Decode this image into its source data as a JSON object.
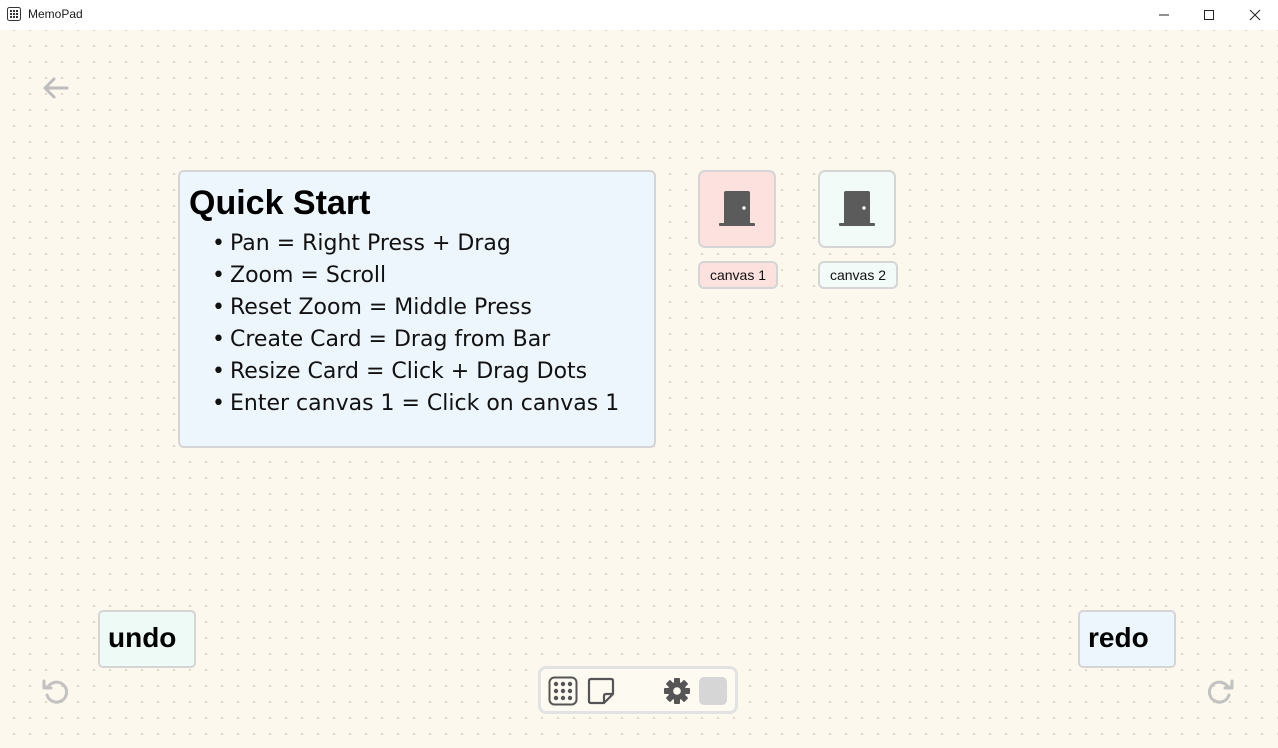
{
  "window": {
    "title": "MemoPad"
  },
  "quick_start": {
    "title": "Quick Start",
    "bullet": "•",
    "items": [
      "Pan = Right Press + Drag",
      "Zoom = Scroll",
      "Reset Zoom = Middle Press",
      "Create Card = Drag from Bar",
      "Resize Card = Click + Drag Dots",
      "Enter canvas 1 = Click on canvas 1"
    ]
  },
  "canvases": [
    {
      "label": "canvas 1",
      "color": "#fce1df"
    },
    {
      "label": "canvas 2",
      "color": "#f2fbf7"
    }
  ],
  "actions": {
    "undo": "undo",
    "redo": "redo"
  },
  "icons": {
    "back": "arrow-left-icon",
    "undo": "rotate-ccw-icon",
    "redo": "rotate-cw-icon",
    "grid": "dot-grid-icon",
    "note": "sticky-note-icon",
    "settings": "gear-icon",
    "color": "color-swatch"
  },
  "colors": {
    "background": "#fdf8ee",
    "card_blue": "#eef6fd",
    "swatch": "#d6d6d6"
  }
}
